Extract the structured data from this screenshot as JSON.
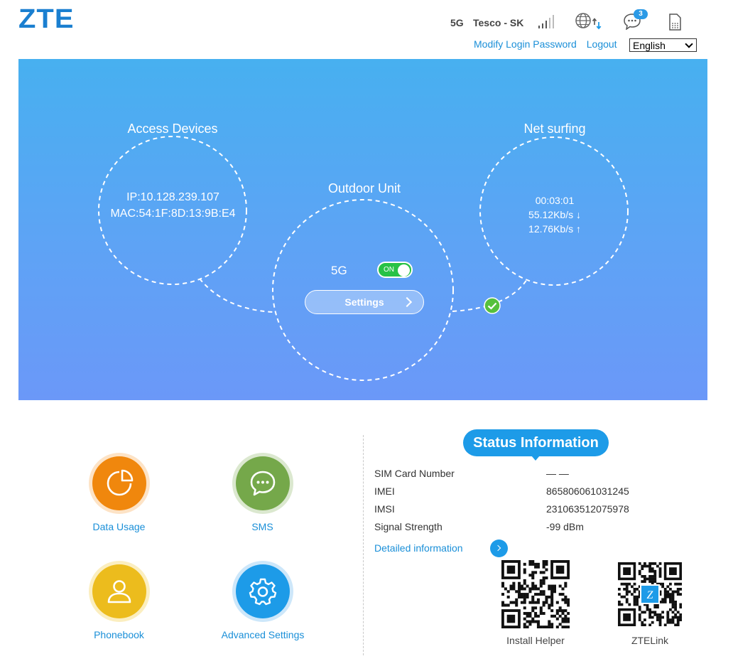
{
  "header": {
    "logo": "ZTE",
    "network_type": "5G",
    "operator": "Tesco - SK",
    "message_count": "3",
    "modify_password_label": "Modify Login Password",
    "logout_label": "Logout",
    "language_selected": "English"
  },
  "hero": {
    "access_devices": {
      "title": "Access Devices",
      "ip": "IP:10.128.239.107",
      "mac": "MAC:54:1F:8D:13:9B:E4"
    },
    "outdoor_unit": {
      "title": "Outdoor Unit",
      "band_label": "5G",
      "toggle_state": "ON",
      "settings_label": "Settings"
    },
    "net_surfing": {
      "title": "Net surfing",
      "connected_time": "00:03:01",
      "download_rate": "55.12Kb/s ↓",
      "upload_rate": "12.76Kb/s ↑"
    }
  },
  "quick_links": [
    {
      "label": "Data Usage",
      "icon": "pie-chart-icon",
      "color": "#f0870d"
    },
    {
      "label": "SMS",
      "icon": "chat-bubble-icon",
      "color": "#75a84a"
    },
    {
      "label": "Phonebook",
      "icon": "person-icon",
      "color": "#ecbc1d"
    },
    {
      "label": "Advanced Settings",
      "icon": "gear-icon",
      "color": "#1d9be8"
    }
  ],
  "status": {
    "title": "Status Information",
    "rows": [
      {
        "label": "SIM Card Number",
        "value": "— —"
      },
      {
        "label": "IMEI",
        "value": "865806061031245"
      },
      {
        "label": "IMSI",
        "value": "231063512075978"
      },
      {
        "label": "Signal Strength",
        "value": "-99 dBm"
      }
    ],
    "detail_label": "Detailed information",
    "qr_codes": [
      {
        "label": "Install Helper"
      },
      {
        "label": "ZTELink"
      }
    ]
  },
  "colors": {
    "accent": "#1d9be8",
    "link": "#1a8fd8",
    "toggle_on": "#27c246",
    "hero_top": "#47b0f0",
    "hero_bottom": "#6b98f8"
  }
}
